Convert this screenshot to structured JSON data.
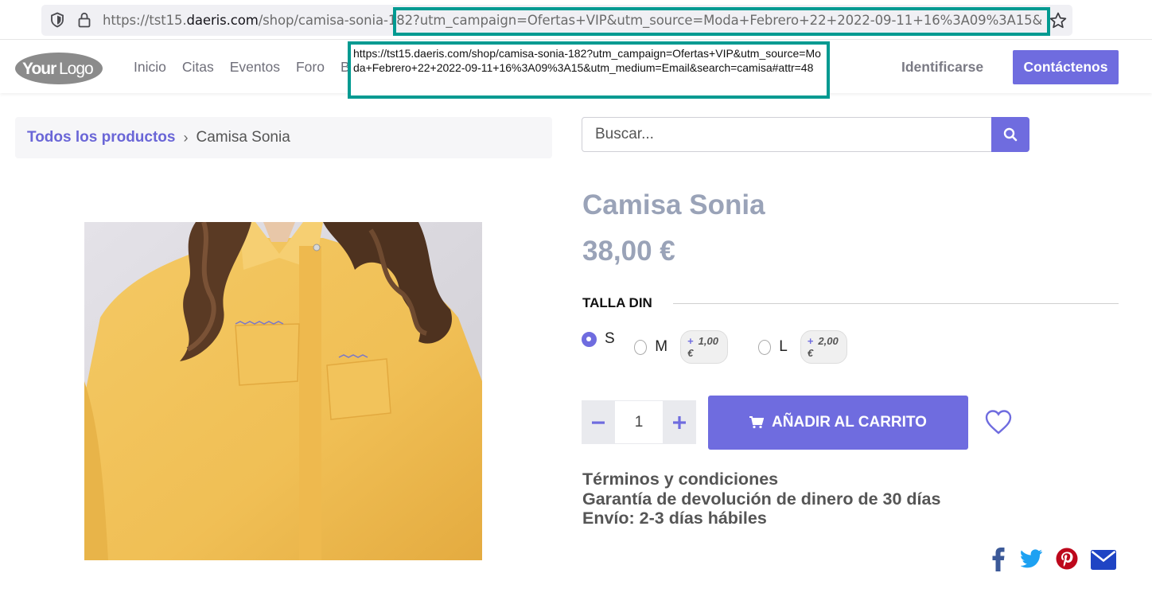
{
  "browser": {
    "url_prefix": "https://tst15.",
    "url_host": "daeris.com",
    "url_rest": "/shop/camisa-sonia-182?utm_campaign=Ofertas+VIP&utm_source=Moda+Febrero+22+2022-09-11+16%3A09%3A15&utm_medium=Email&search=camisa#attr=48",
    "tooltip": "https://tst15.daeris.com/shop/camisa-sonia-182?utm_campaign=Ofertas+VIP&utm_source=Moda+Febrero+22+2022-09-11+16%3A09%3A15&utm_medium=Email&search=camisa#attr=48",
    "highlight_color": "#009a91"
  },
  "navbar": {
    "logo_text": "YourLogo",
    "links": [
      "Inicio",
      "Citas",
      "Eventos",
      "Foro",
      "Blog"
    ],
    "signin_label": "Identificarse",
    "contact_label": "Contáctenos"
  },
  "breadcrumb": {
    "link": "Todos los productos",
    "current": "Camisa Sonia"
  },
  "search": {
    "placeholder": "Buscar..."
  },
  "product": {
    "title": "Camisa Sonia",
    "price": "38,00 €",
    "attribute_label": "TALLA DIN",
    "options": [
      {
        "label": "S",
        "extra": "",
        "selected": true
      },
      {
        "label": "M",
        "extra": "1,00 €",
        "selected": false
      },
      {
        "label": "L",
        "extra": "2,00 €",
        "selected": false
      }
    ],
    "quantity": "1",
    "add_to_cart_label": "AÑADIR AL CARRITO",
    "terms": [
      "Términos y condiciones",
      "Garantía de devolución de dinero de 30 días",
      "Envío: 2-3 días hábiles"
    ],
    "badge_plus": "+"
  },
  "colors": {
    "accent": "#6f6cdf",
    "title_gray": "#9aa3b8"
  },
  "icons": [
    "shield-icon",
    "lock-icon",
    "star-icon",
    "search-icon",
    "minus-icon",
    "plus-icon",
    "cart-icon",
    "heart-icon",
    "facebook-icon",
    "twitter-icon",
    "pinterest-icon",
    "email-icon"
  ]
}
